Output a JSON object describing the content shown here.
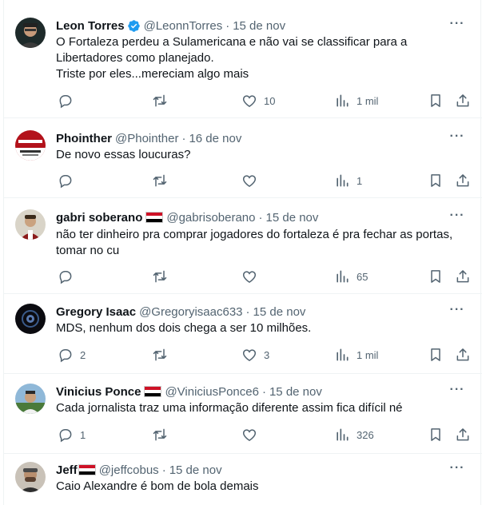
{
  "tweets": [
    {
      "name": "Leon Torres",
      "handle": "@LeonnTorres",
      "dot": "·",
      "time": "15 de nov",
      "verified": true,
      "flag": false,
      "text_lines": [
        "O Fortaleza perdeu a Sulamericana e não vai se classificar para a",
        "Libertadores como planejado.",
        "Triste por eles...mereciam algo mais"
      ],
      "replies": "",
      "retweets": "",
      "likes": "10",
      "views": "1 mil"
    },
    {
      "name": "Phointher",
      "handle": "@Phointher",
      "dot": "·",
      "time": "16 de nov",
      "verified": false,
      "flag": false,
      "text_lines": [
        "De novo essas loucuras?"
      ],
      "replies": "",
      "retweets": "",
      "likes": "",
      "views": "1"
    },
    {
      "name": "gabri soberano",
      "handle": "@gabrisoberano",
      "dot": "·",
      "time": "15 de nov",
      "verified": false,
      "flag": true,
      "text_lines": [
        "não ter dinheiro pra comprar jogadores do fortaleza é pra fechar as portas,",
        "tomar no cu"
      ],
      "replies": "",
      "retweets": "",
      "likes": "",
      "views": "65"
    },
    {
      "name": "Gregory Isaac",
      "handle": "@Gregoryisaac633",
      "dot": "·",
      "time": "15 de nov",
      "verified": false,
      "flag": false,
      "text_lines": [
        "MDS, nenhum dos dois chega a ser 10 milhões."
      ],
      "replies": "2",
      "retweets": "",
      "likes": "3",
      "views": "1 mil"
    },
    {
      "name": "Vinicius Ponce",
      "handle": "@ViniciusPonce6",
      "dot": "·",
      "time": "15 de nov",
      "verified": false,
      "flag": true,
      "text_lines": [
        "Cada jornalista traz uma informação diferente assim fica difícil né"
      ],
      "replies": "1",
      "retweets": "",
      "likes": "",
      "views": "326"
    },
    {
      "name": "Jeff",
      "handle": "@jeffcobus",
      "dot": "·",
      "time": "15 de nov",
      "verified": false,
      "flag": true,
      "text_lines": [
        "Caio Alexandre é bom de bola demais"
      ],
      "replies": "",
      "retweets": "",
      "likes": "",
      "views": ""
    }
  ],
  "more_label": "···",
  "icons": [
    "reply-icon",
    "retweet-icon",
    "like-icon",
    "views-icon",
    "bookmark-icon",
    "share-icon",
    "verified-badge-icon",
    "flag-icon"
  ],
  "colors": {
    "text": "#0f1419",
    "muted": "#536471",
    "verified": "#1d9bf0",
    "divider": "#eff3f4"
  }
}
